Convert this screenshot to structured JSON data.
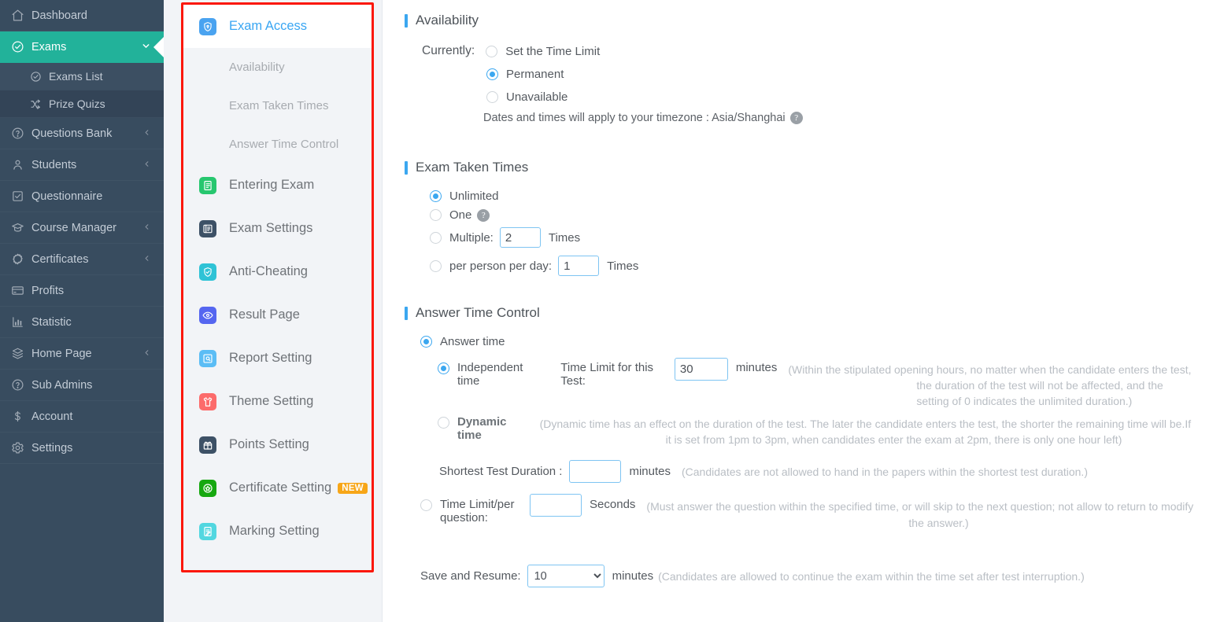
{
  "sidebar": {
    "items": [
      {
        "label": "Dashboard",
        "icon": "home-icon",
        "chevron": false,
        "active": false
      },
      {
        "label": "Exams",
        "icon": "check-circle-icon",
        "chevron": true,
        "chevron_dir": "down",
        "active": true
      },
      {
        "label": "Questions Bank",
        "icon": "question-circle-icon",
        "chevron": true,
        "chevron_dir": "left",
        "active": false
      },
      {
        "label": "Students",
        "icon": "users-icon",
        "chevron": true,
        "chevron_dir": "left",
        "active": false
      },
      {
        "label": "Questionnaire",
        "icon": "checkbox-icon",
        "chevron": false,
        "active": false
      },
      {
        "label": "Course Manager",
        "icon": "graduation-cap-icon",
        "chevron": true,
        "chevron_dir": "left",
        "active": false
      },
      {
        "label": "Certificates",
        "icon": "seal-icon",
        "chevron": true,
        "chevron_dir": "left",
        "active": false
      },
      {
        "label": "Profits",
        "icon": "card-icon",
        "chevron": false,
        "active": false
      },
      {
        "label": "Statistic",
        "icon": "bar-chart-icon",
        "chevron": false,
        "active": false
      },
      {
        "label": "Home Page",
        "icon": "layers-icon",
        "chevron": true,
        "chevron_dir": "left",
        "active": false
      },
      {
        "label": "Sub Admins",
        "icon": "question-circle-icon",
        "chevron": false,
        "active": false
      },
      {
        "label": "Account",
        "icon": "dollar-icon",
        "chevron": false,
        "active": false
      },
      {
        "label": "Settings",
        "icon": "gear-icon",
        "chevron": false,
        "active": false
      }
    ],
    "submenu": [
      {
        "label": "Exams List",
        "icon": "check-circle-icon",
        "highlighted": true
      },
      {
        "label": "Prize Quizs",
        "icon": "shuffle-icon",
        "highlighted": false
      }
    ]
  },
  "subnav": {
    "items": [
      {
        "label": "Exam Access",
        "icon": "shield-lock-icon",
        "color": "#4aa3f0",
        "active": true,
        "badge": ""
      },
      {
        "label": "Entering Exam",
        "icon": "list-doc-icon",
        "color": "#27c76f",
        "active": false,
        "badge": ""
      },
      {
        "label": "Exam Settings",
        "icon": "settings-doc-icon",
        "color": "#3d5166",
        "active": false,
        "badge": ""
      },
      {
        "label": "Anti-Cheating",
        "icon": "shield-check-icon",
        "color": "#2fc3d6",
        "active": false,
        "badge": ""
      },
      {
        "label": "Result Page",
        "icon": "eye-icon",
        "color": "#5566f0",
        "active": false,
        "badge": ""
      },
      {
        "label": "Report Setting",
        "icon": "report-icon",
        "color": "#5bbdf5",
        "active": false,
        "badge": ""
      },
      {
        "label": "Theme Setting",
        "icon": "shirt-icon",
        "color": "#fc6b6b",
        "active": false,
        "badge": ""
      },
      {
        "label": "Points Setting",
        "icon": "gift-icon",
        "color": "#3d5166",
        "active": false,
        "badge": ""
      },
      {
        "label": "Certificate Setting",
        "icon": "certificate-seal-icon",
        "color": "#16a810",
        "active": false,
        "badge": "NEW"
      },
      {
        "label": "Marking Setting",
        "icon": "marking-doc-icon",
        "color": "#52d7e0",
        "active": false,
        "badge": ""
      }
    ],
    "sub_items": [
      {
        "label": "Availability"
      },
      {
        "label": "Exam Taken Times"
      },
      {
        "label": "Answer Time Control"
      }
    ]
  },
  "availability": {
    "title": "Availability",
    "currently_label": "Currently:",
    "options": [
      {
        "label": "Set the Time Limit",
        "selected": false
      },
      {
        "label": "Permanent",
        "selected": true
      },
      {
        "label": "Unavailable",
        "selected": false
      }
    ],
    "timezone_note": "Dates and times will apply to your timezone : Asia/Shanghai",
    "help_icon": "question-mark-icon"
  },
  "exam_taken_times": {
    "title": "Exam Taken Times",
    "options": [
      {
        "label": "Unlimited",
        "selected": true,
        "help": false
      },
      {
        "label": "One",
        "selected": false,
        "help": true
      },
      {
        "label": "Multiple:",
        "selected": false,
        "value": "2",
        "unit": "Times",
        "help": false
      },
      {
        "label": "per person per day:",
        "selected": false,
        "value": "1",
        "unit": "Times",
        "help": false
      }
    ]
  },
  "answer_time_control": {
    "title": "Answer Time Control",
    "answer_time": {
      "label": "Answer time",
      "selected": true
    },
    "independent_time": {
      "label": "Independent time",
      "selected": true,
      "field_label": "Time Limit for this Test:",
      "value": "30",
      "unit": "minutes",
      "hint": "(Within the stipulated opening hours, no matter when the candidate enters the test, the duration of the test will not be affected, and the setting of 0 indicates the unlimited duration.)"
    },
    "dynamic_time": {
      "label": "Dynamic time",
      "selected": false,
      "hint": "(Dynamic time has an effect on the duration of the test. The later the candidate enters the test, the shorter the remaining time will be.If it is set from 1pm to 3pm, when candidates enter the exam at 2pm, there is only one hour left)"
    },
    "shortest_test_duration": {
      "label": "Shortest Test Duration :",
      "value": "",
      "unit": "minutes",
      "hint": "(Candidates are not allowed to hand in the papers within the shortest test duration.)"
    },
    "time_limit_per_question": {
      "label": "Time Limit/per question:",
      "selected": false,
      "value": "",
      "unit": "Seconds",
      "hint": "(Must answer the question within the specified time, or will skip to the next question; not allow to return to modify the answer.)"
    },
    "save_and_resume": {
      "label": "Save and Resume:",
      "value": "10",
      "options": [
        "10"
      ],
      "unit": "minutes",
      "hint": "(Candidates are allowed to continue the exam within the time set after test interruption.)"
    }
  },
  "colors": {
    "sidebar_bg": "#384c5f",
    "active_green": "#22b29a",
    "accent_blue": "#3ba7f0",
    "highlight_red": "#fb1708",
    "badge_orange": "#f7a618"
  }
}
